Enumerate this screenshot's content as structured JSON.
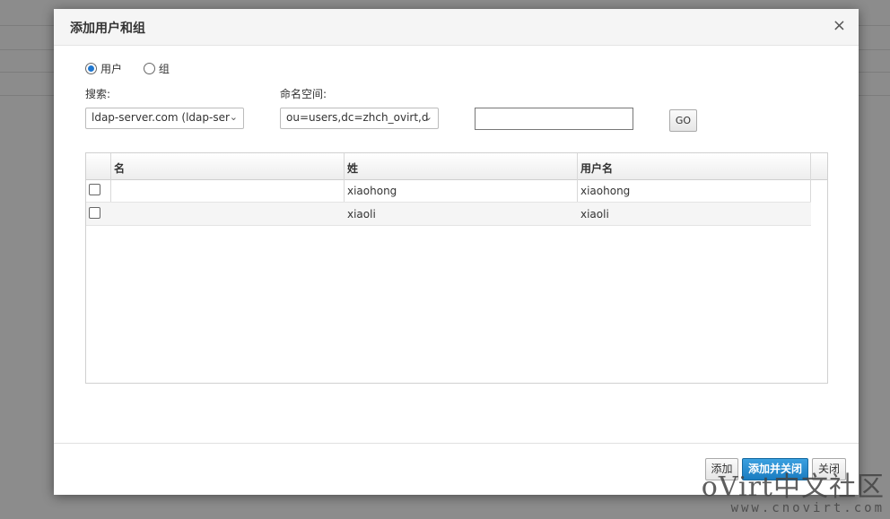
{
  "dialog": {
    "title": "添加用户和组",
    "close_glyph": "×"
  },
  "type_options": [
    {
      "label": "用户",
      "selected": true
    },
    {
      "label": "组",
      "selected": false
    }
  ],
  "search": {
    "label": "搜索:",
    "selected": "ldap-server.com (ldap-ser"
  },
  "namespace": {
    "label": "命名空间:",
    "selected": "ou=users,dc=zhch_ovirt,d"
  },
  "query": {
    "value": ""
  },
  "go_label": "GO",
  "table": {
    "columns": [
      "名",
      "姓",
      "用户名"
    ],
    "rows": [
      {
        "first": "",
        "last": "xiaohong",
        "username": "xiaohong",
        "checked": false
      },
      {
        "first": "",
        "last": "xiaoli",
        "username": "xiaoli",
        "checked": false
      }
    ]
  },
  "footer": {
    "add_label": "添加",
    "add_close_label": "添加并关闭",
    "close_label": "关闭"
  },
  "watermark": {
    "main": "oVirt中文社区",
    "sub": "www.cnovirt.com"
  },
  "colors": {
    "primary_button": "#1a7cc0",
    "overlay": "#8c8c8c"
  },
  "icons": {
    "close": "close-icon",
    "dropdown": "chevron-down-icon"
  }
}
